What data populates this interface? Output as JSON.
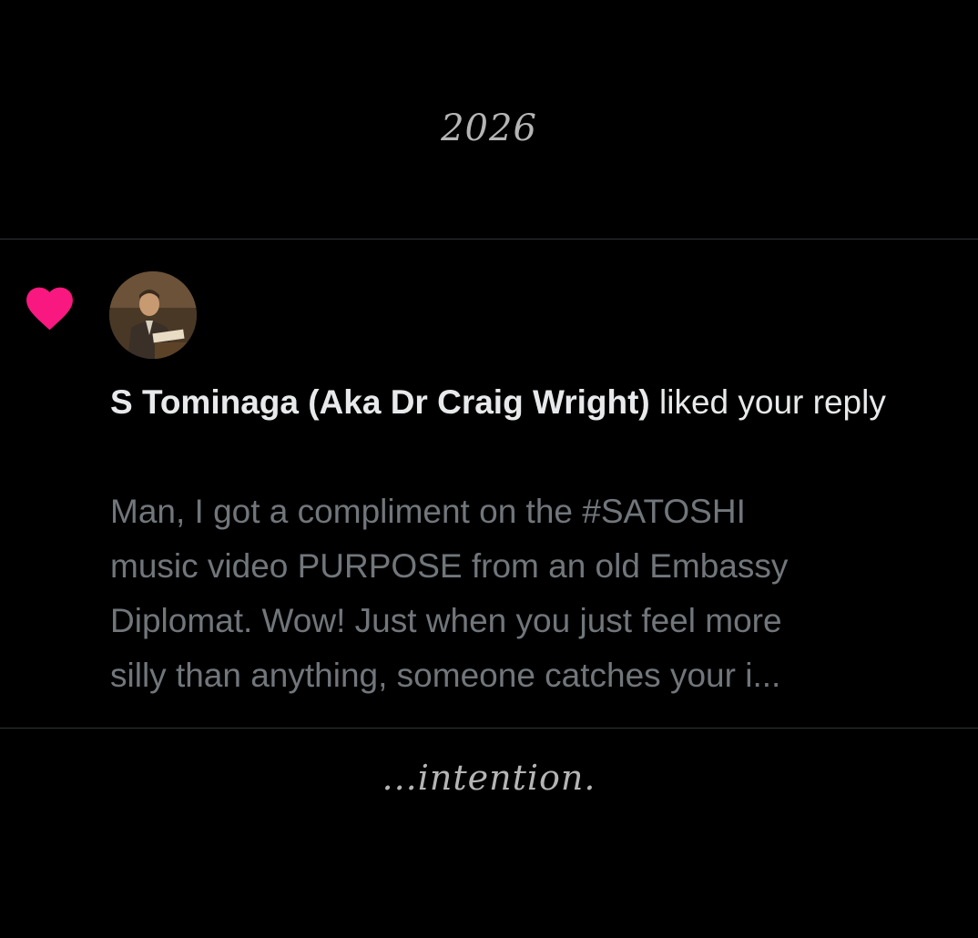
{
  "top_caption": "2026",
  "notification": {
    "icon": "heart-icon",
    "heart_color": "#f91880",
    "author": "S Tominaga (Aka Dr Craig Wright)",
    "action": " liked your reply",
    "preview_lines": [
      "Man, I got a compliment on the #SATOSHI",
      "music video PURPOSE from an old Embassy",
      "Diplomat. Wow! Just when you just feel more",
      "silly than anything, someone catches your i..."
    ]
  },
  "bottom_caption": "...intention.",
  "colors": {
    "background": "#000000",
    "primary_text": "#e7e9ea",
    "secondary_text": "#71767b",
    "divider": "#2f3336",
    "caption_text": "#b5b5b5"
  }
}
